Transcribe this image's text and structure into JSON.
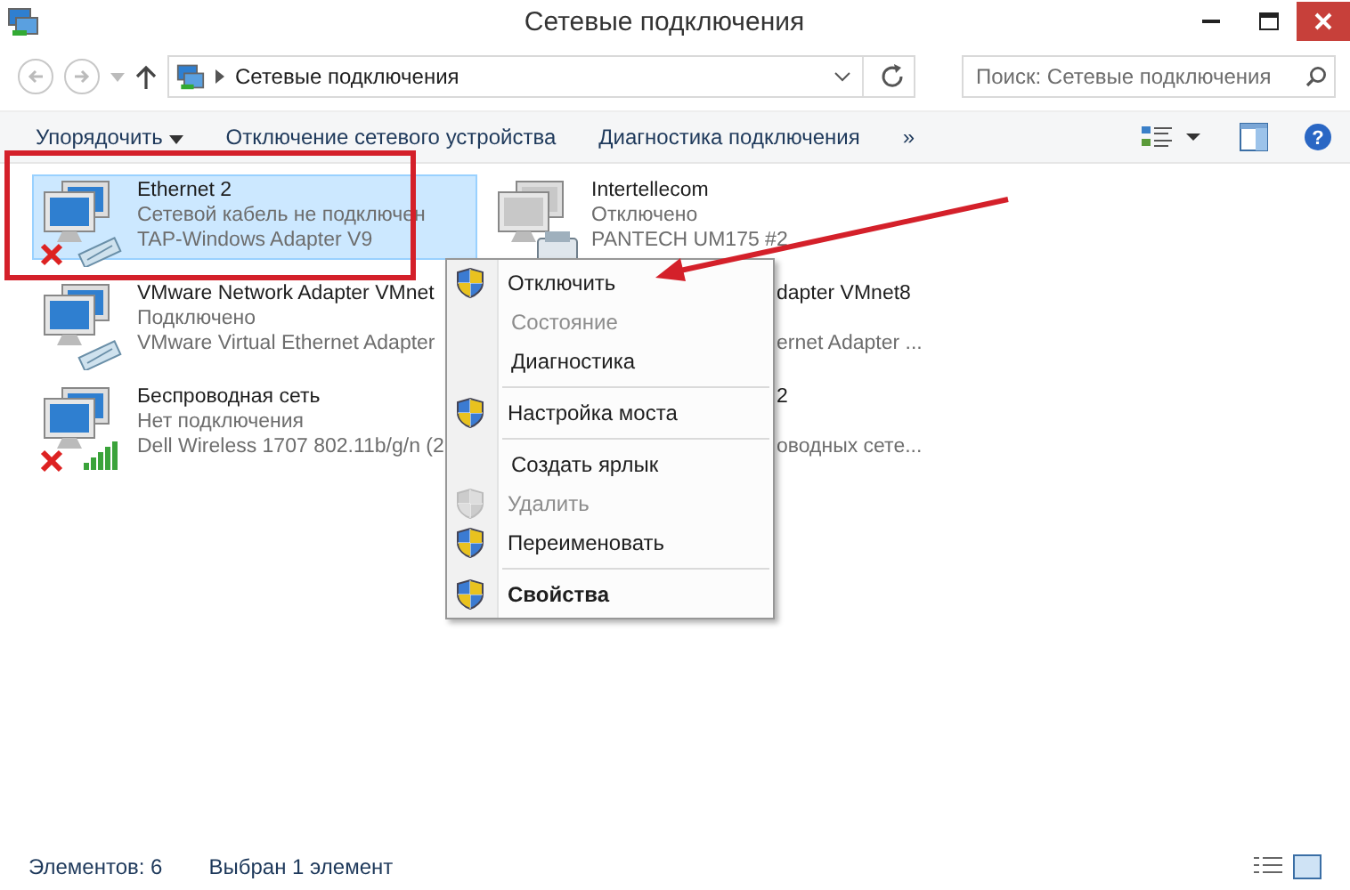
{
  "window": {
    "title": "Сетевые подключения"
  },
  "address_bar": {
    "path": "Сетевые подключения"
  },
  "search": {
    "placeholder": "Поиск: Сетевые подключения"
  },
  "toolbar": {
    "items": [
      "Упорядочить",
      "Отключение сетевого устройства",
      "Диагностика подключения",
      "»"
    ],
    "help": "?"
  },
  "connections": [
    {
      "kind": "cable",
      "name": "Ethernet 2",
      "status": "Сетевой кабель не подключен",
      "device": "TAP-Windows Adapter V9",
      "selected": true,
      "error": true
    },
    {
      "kind": "modem",
      "name": "Intertellecom",
      "status": "Отключено",
      "device": "PANTECH UM175 #2",
      "selected": false,
      "error": false
    },
    {
      "kind": "cable",
      "name": "VMware Network Adapter VMnet",
      "status": "Подключено",
      "device": "VMware Virtual Ethernet Adapter",
      "selected": false,
      "error": false
    },
    {
      "kind": "covered",
      "name": "dapter VMnet8",
      "device": "ernet Adapter ...",
      "selected": false
    },
    {
      "kind": "wifi",
      "name": "Беспроводная сеть",
      "status": "Нет подключения",
      "device": "Dell Wireless 1707 802.11b/g/n (2",
      "selected": false,
      "error": true
    },
    {
      "kind": "covered",
      "name": "2",
      "device": "оводных сете...",
      "selected": false
    }
  ],
  "context_menu": [
    {
      "label": "Отключить",
      "shield": true,
      "disabled": false,
      "default": false,
      "separator_after": false
    },
    {
      "label": "Состояние",
      "shield": false,
      "disabled": true,
      "default": false,
      "separator_after": false
    },
    {
      "label": "Диагностика",
      "shield": false,
      "disabled": false,
      "default": false,
      "separator_after": true
    },
    {
      "label": "Настройка моста",
      "shield": true,
      "disabled": false,
      "default": false,
      "separator_after": true
    },
    {
      "label": "Создать ярлык",
      "shield": false,
      "disabled": false,
      "default": false,
      "separator_after": false
    },
    {
      "label": "Удалить",
      "shield": true,
      "disabled": true,
      "default": false,
      "separator_after": false
    },
    {
      "label": "Переименовать",
      "shield": true,
      "disabled": false,
      "default": false,
      "separator_after": true
    },
    {
      "label": "Свойства",
      "shield": true,
      "disabled": false,
      "default": true,
      "separator_after": false
    }
  ],
  "status_bar": {
    "count": "Элементов: 6",
    "selection": "Выбран 1 элемент"
  }
}
